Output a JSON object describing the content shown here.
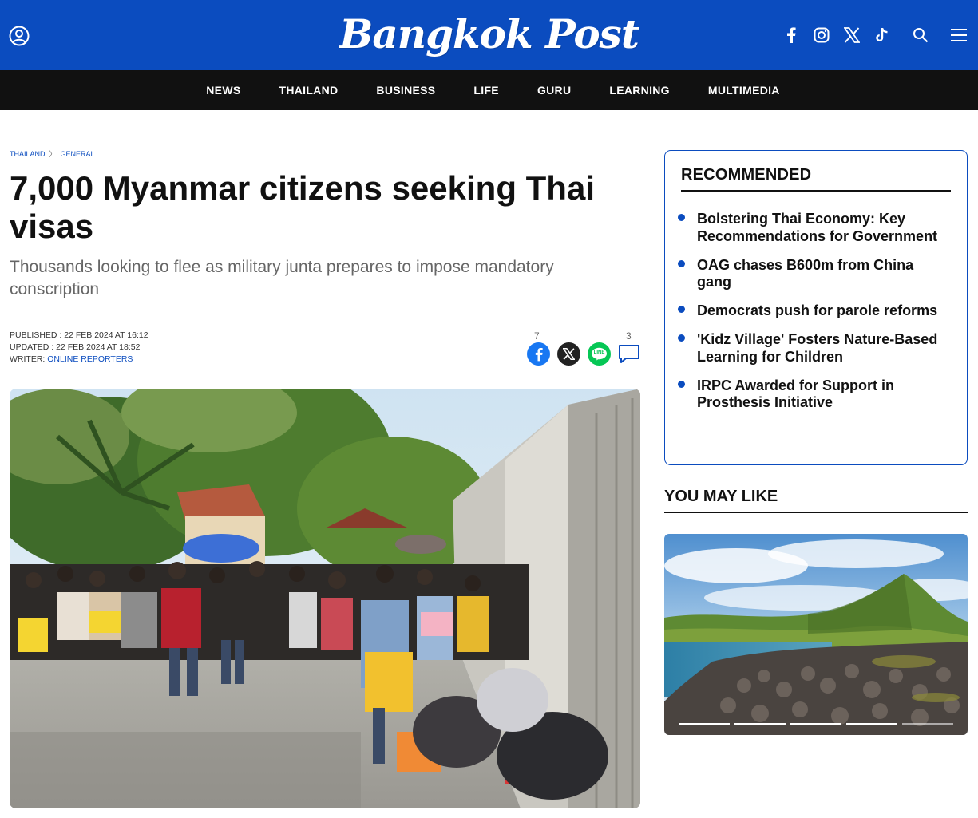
{
  "header": {
    "logo_text": "Bangkok Post",
    "brand_color": "#0b4cbf",
    "icons": [
      "user-icon",
      "facebook-icon",
      "instagram-icon",
      "x-icon",
      "tiktok-icon",
      "search-icon",
      "menu-icon"
    ]
  },
  "nav": {
    "items": [
      "NEWS",
      "THAILAND",
      "BUSINESS",
      "LIFE",
      "GURU",
      "LEARNING",
      "MULTIMEDIA"
    ]
  },
  "breadcrumb": {
    "section": "THAILAND",
    "separator": "〉",
    "subsection": "GENERAL"
  },
  "article": {
    "title": "7,000 Myanmar citizens seeking Thai visas",
    "subtitle": "Thousands looking to flee as military junta prepares to impose mandatory conscription",
    "published_label": "PUBLISHED :",
    "published": "22 FEB 2024 AT 16:12",
    "updated_label": "UPDATED :",
    "updated": "22 FEB 2024 AT 18:52",
    "writer_label": "WRITER:",
    "writer": "ONLINE REPORTERS",
    "share": {
      "facebook_count": "7",
      "comment_count": "3",
      "line_label": "LINE",
      "facebook_color": "#1877f2",
      "x_color": "#222222",
      "line_color": "#06c755"
    }
  },
  "sidebar": {
    "recommended_title": "RECOMMENDED",
    "recommended": [
      "Bolstering Thai Economy: Key Recommendations for Government",
      "OAG chases B600m from China gang",
      "Democrats push for parole reforms",
      "'Kidz Village' Fosters Nature-Based Learning for Children",
      "IRPC Awarded for Support in Prosthesis Initiative"
    ],
    "you_may_like_title": "YOU MAY LIKE",
    "carousel_slides": 5,
    "carousel_active": 1
  }
}
